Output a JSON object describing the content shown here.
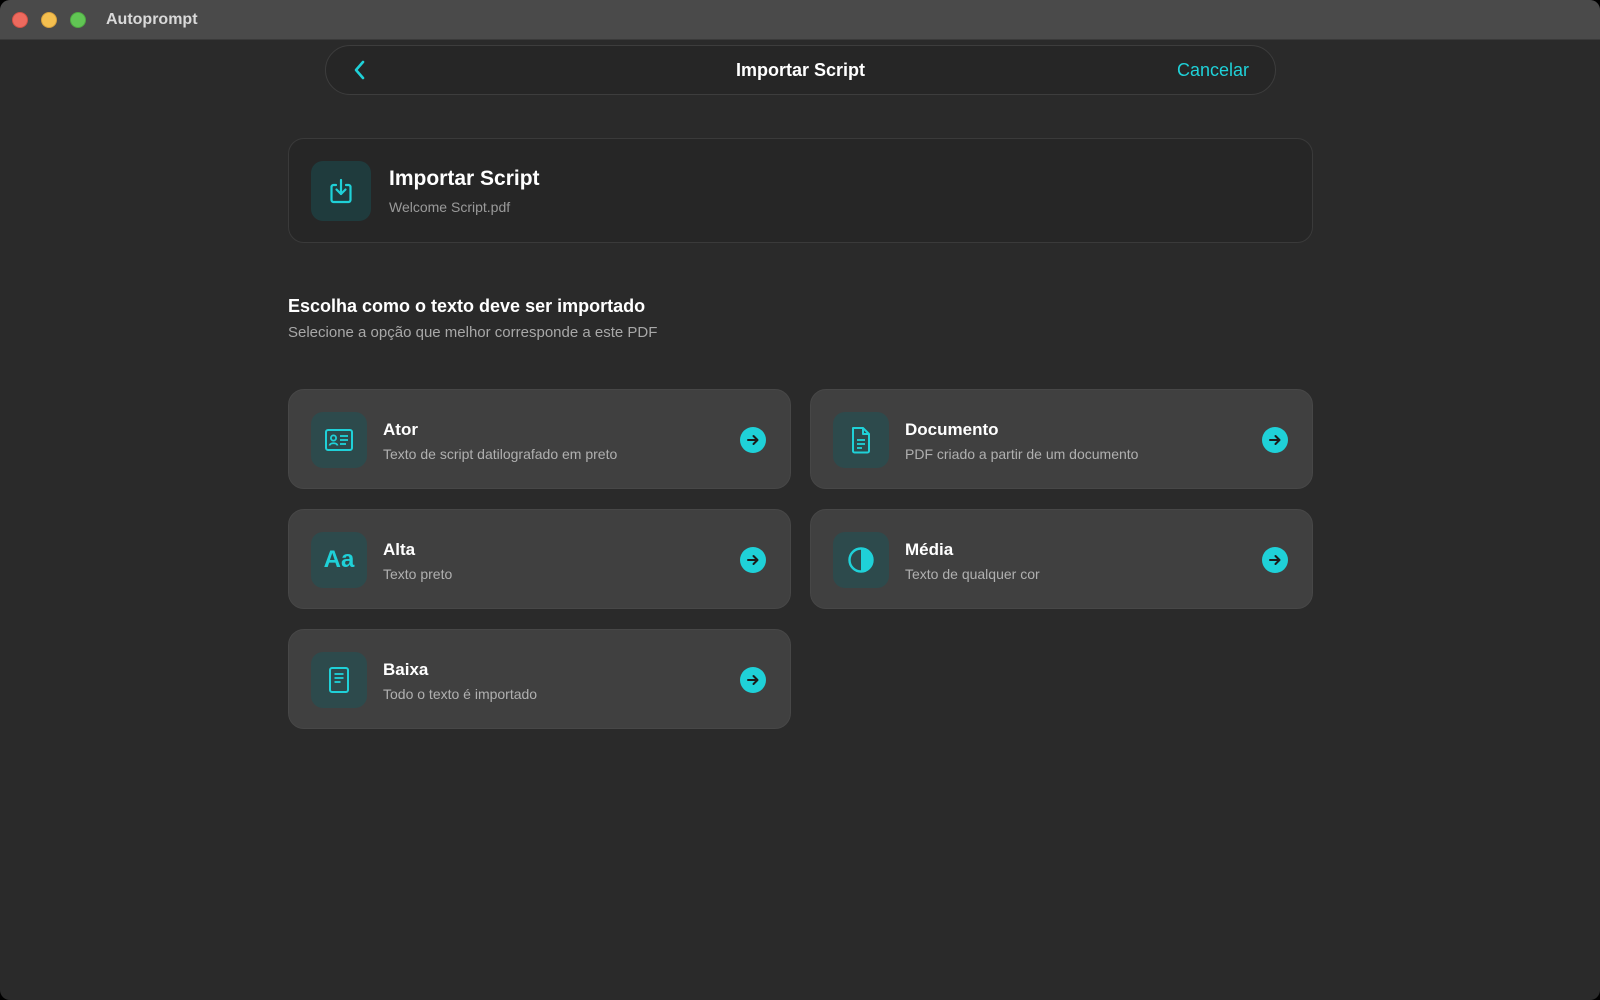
{
  "window": {
    "app_title": "Autoprompt"
  },
  "navbar": {
    "title": "Importar Script",
    "cancel_label": "Cancelar",
    "back_icon": "chevron-left-icon"
  },
  "file": {
    "title": "Importar Script",
    "filename": "Welcome Script.pdf",
    "icon": "import-icon"
  },
  "section": {
    "title": "Escolha como o texto deve ser importado",
    "subtitle": "Selecione a opção que melhor corresponde a este PDF"
  },
  "options": [
    {
      "title": "Ator",
      "subtitle": "Texto de script datilografado em preto",
      "icon": "id-card-icon"
    },
    {
      "title": "Documento",
      "subtitle": "PDF criado a partir de um documento",
      "icon": "document-icon"
    },
    {
      "title": "Alta",
      "subtitle": "Texto preto",
      "icon": "text-format-icon",
      "glyph": "Aa"
    },
    {
      "title": "Média",
      "subtitle": "Texto de qualquer cor",
      "icon": "half-circle-icon"
    },
    {
      "title": "Baixa",
      "subtitle": "Todo o texto é importado",
      "icon": "page-icon"
    }
  ],
  "colors": {
    "accent": "#1fd1d8",
    "background": "#2a2a2a",
    "card": "#404040",
    "icon_box": "#2d4a4c"
  }
}
